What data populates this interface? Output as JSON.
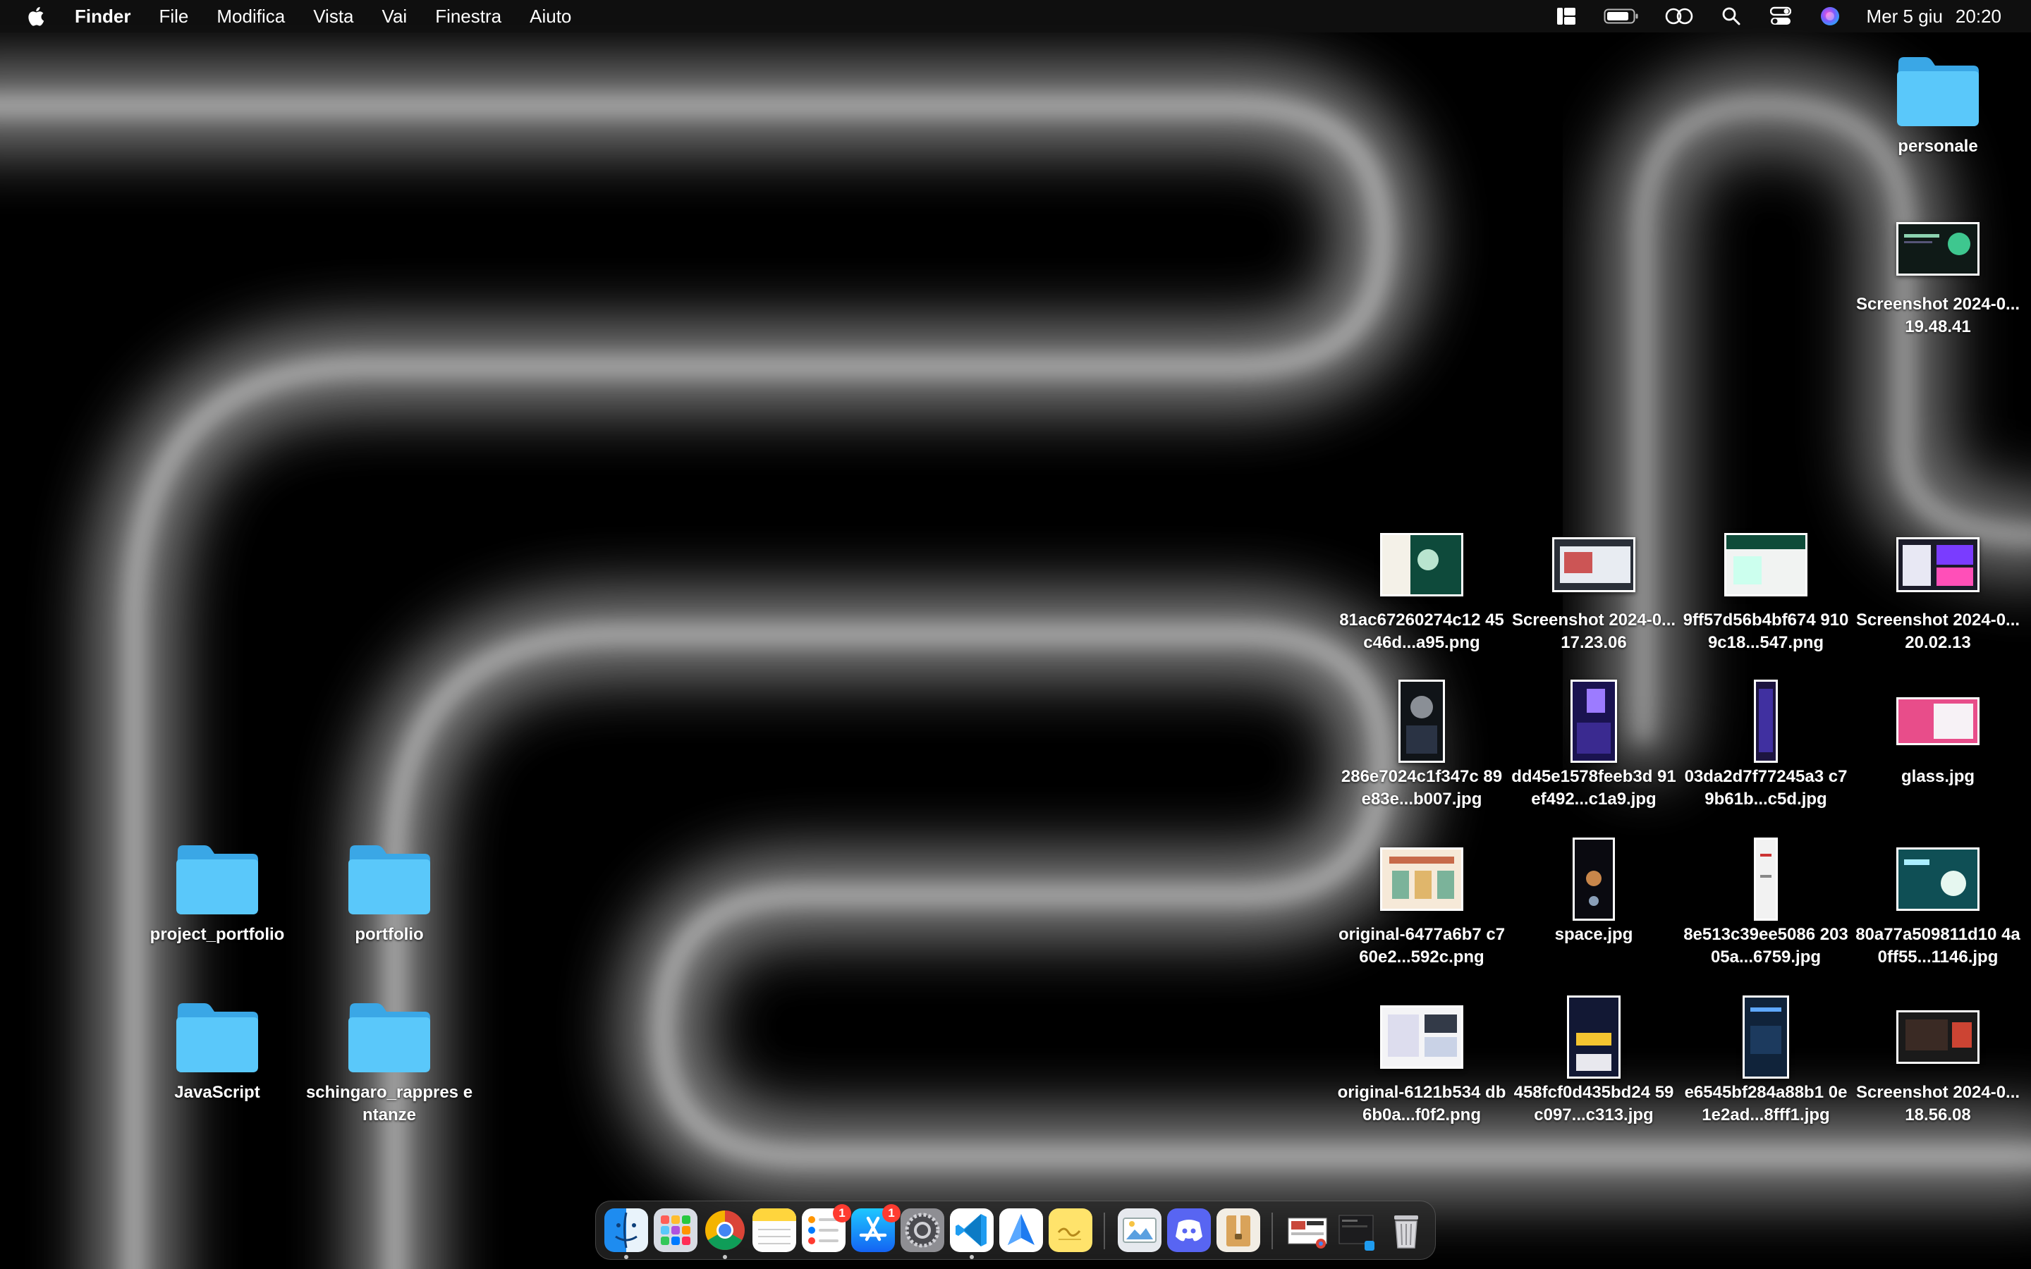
{
  "menubar": {
    "app_name": "Finder",
    "menus": [
      "File",
      "Modifica",
      "Vista",
      "Vai",
      "Finestra",
      "Aiuto"
    ],
    "status_icons": [
      "stage-manager-icon",
      "battery-icon",
      "screen-mirroring-icon",
      "spotlight-search-icon",
      "control-center-icon",
      "siri-icon"
    ],
    "date": "Mer 5 giu",
    "time": "20:20"
  },
  "desktop": {
    "folder_color": "#5ac8fa",
    "items": [
      {
        "label": "personale",
        "kind": "folder"
      },
      {
        "label": "Screenshot 2024-0...19.48.41",
        "kind": "image"
      },
      {
        "label": "81ac67260274c12 45c46d...a95.png",
        "kind": "image"
      },
      {
        "label": "Screenshot 2024-0...17.23.06",
        "kind": "image"
      },
      {
        "label": "9ff57d56b4bf674 9109c18...547.png",
        "kind": "image"
      },
      {
        "label": "Screenshot 2024-0...20.02.13",
        "kind": "image"
      },
      {
        "label": "286e7024c1f347c 89e83e...b007.jpg",
        "kind": "image"
      },
      {
        "label": "dd45e1578feeb3d 91ef492...c1a9.jpg",
        "kind": "image"
      },
      {
        "label": "03da2d7f77245a3 c79b61b...c5d.jpg",
        "kind": "image"
      },
      {
        "label": "glass.jpg",
        "kind": "image"
      },
      {
        "label": "original-6477a6b7 c760e2...592c.png",
        "kind": "image"
      },
      {
        "label": "space.jpg",
        "kind": "image"
      },
      {
        "label": "8e513c39ee5086 20305a...6759.jpg",
        "kind": "image"
      },
      {
        "label": "80a77a509811d10 4a0ff55...1146.jpg",
        "kind": "image"
      },
      {
        "label": "original-6121b534 db6b0a...f0f2.png",
        "kind": "image"
      },
      {
        "label": "458fcf0d435bd24 59c097...c313.jpg",
        "kind": "image"
      },
      {
        "label": "e6545bf284a88b1 0e1e2ad...8fff1.jpg",
        "kind": "image"
      },
      {
        "label": "Screenshot 2024-0...18.56.08",
        "kind": "image"
      },
      {
        "label": "project_portfolio",
        "kind": "folder"
      },
      {
        "label": "portfolio",
        "kind": "folder"
      },
      {
        "label": "JavaScript",
        "kind": "folder"
      },
      {
        "label": "schingaro_rappres entanze",
        "kind": "folder"
      }
    ]
  },
  "dock": {
    "apps": [
      {
        "name": "Finder",
        "icon": "finder-icon",
        "running": true
      },
      {
        "name": "Launchpad",
        "icon": "launchpad-icon",
        "running": false
      },
      {
        "name": "Google Chrome",
        "icon": "chrome-icon",
        "running": true
      },
      {
        "name": "Notes",
        "icon": "notes-icon",
        "running": false
      },
      {
        "name": "Reminders",
        "icon": "reminders-icon",
        "running": false,
        "badge": "1"
      },
      {
        "name": "App Store",
        "icon": "app-store-icon",
        "running": false,
        "badge": "1"
      },
      {
        "name": "System Settings",
        "icon": "system-settings-icon",
        "running": false
      },
      {
        "name": "Visual Studio Code",
        "icon": "vscode-icon",
        "running": true
      },
      {
        "name": "Spark",
        "icon": "spark-mail-icon",
        "running": false
      },
      {
        "name": "Stickies",
        "icon": "stickies-icon",
        "running": false
      },
      {
        "name": "Preview",
        "icon": "preview-icon",
        "running": false
      },
      {
        "name": "Discord",
        "icon": "discord-icon",
        "running": false
      },
      {
        "name": "Archive Utility",
        "icon": "archive-icon",
        "running": false
      },
      {
        "name": "Recent documents",
        "icon": "recent-stack-icon",
        "running": false
      },
      {
        "name": "Recent windows",
        "icon": "window-stack-icon",
        "running": false
      },
      {
        "name": "Trash",
        "icon": "trash-icon",
        "running": false
      }
    ]
  }
}
